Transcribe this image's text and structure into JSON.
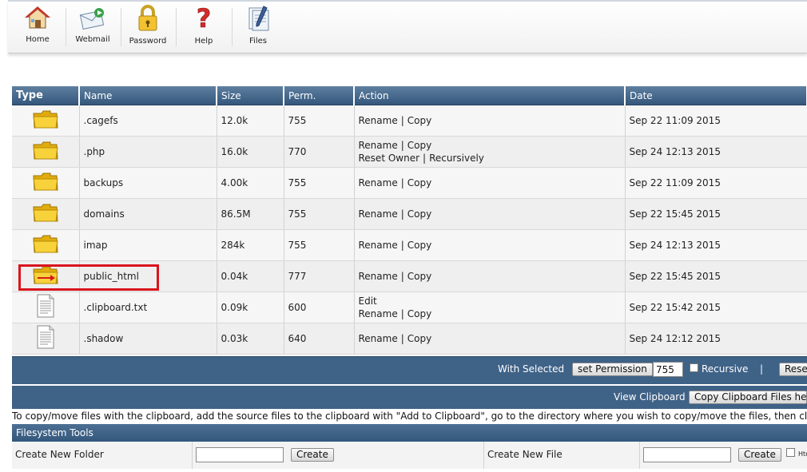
{
  "toolbar": {
    "items": [
      {
        "label": "Home",
        "icon": "home-icon"
      },
      {
        "label": "Webmail",
        "icon": "webmail-icon"
      },
      {
        "label": "Password",
        "icon": "padlock-icon"
      },
      {
        "label": "Help",
        "icon": "question-mark-icon"
      },
      {
        "label": "Files",
        "icon": "files-icon"
      }
    ]
  },
  "table": {
    "headers": {
      "type": "Type",
      "name": "Name",
      "size": "Size",
      "perm": "Perm.",
      "action": "Action",
      "date": "Date"
    },
    "action_labels": {
      "rename": "Rename",
      "copy": "Copy",
      "edit": "Edit",
      "reset_owner": "Reset Owner",
      "recursively": "Recursively",
      "sep": "|"
    },
    "rows": [
      {
        "type": "folder",
        "name": ".cagefs",
        "size": "12.0k",
        "perm": "755",
        "date": "Sep 22 11:09 2015"
      },
      {
        "type": "folder",
        "name": ".php",
        "size": "16.0k",
        "perm": "770",
        "date": "Sep 24 12:13 2015"
      },
      {
        "type": "folder",
        "name": "backups",
        "size": "4.00k",
        "perm": "755",
        "date": "Sep 22 11:09 2015"
      },
      {
        "type": "folder",
        "name": "domains",
        "size": "86.5M",
        "perm": "755",
        "date": "Sep 22 15:45 2015"
      },
      {
        "type": "folder",
        "name": "imap",
        "size": "284k",
        "perm": "755",
        "date": "Sep 24 12:13 2015"
      },
      {
        "type": "folder-link",
        "name": "public_html",
        "size": "0.04k",
        "perm": "777",
        "date": "Sep 22 15:45 2015"
      },
      {
        "type": "file",
        "name": ".clipboard.txt",
        "size": "0.09k",
        "perm": "600",
        "date": "Sep 22 15:42 2015"
      },
      {
        "type": "file",
        "name": ".shadow",
        "size": "0.03k",
        "perm": "640",
        "date": "Sep 24 12:12 2015"
      }
    ]
  },
  "selected_bar": {
    "with_selected": "With Selected",
    "set_permission": "set Permission",
    "perm_value": "755",
    "recursive": "Recursive",
    "sep": "|",
    "reset": "Reset"
  },
  "clipboard_bar": {
    "view_clipboard": "View Clipboard",
    "copy_files": "Copy Clipboard Files here"
  },
  "note": "To copy/move files with the clipboard, add the source files to the clipboard with \"Add to Clipboard\", go to the directory where you wish to copy/move the files, then click \"Copy Clipboard Files here\"",
  "filesystem_tools": {
    "title": "Filesystem Tools",
    "create_folder_label": "Create New Folder",
    "create_file_label": "Create New File",
    "create_button": "Create",
    "html_label": "Html"
  },
  "colors": {
    "header_bg": "#3a5d82",
    "highlight": "#d9141d",
    "folder": "#f5c518"
  }
}
